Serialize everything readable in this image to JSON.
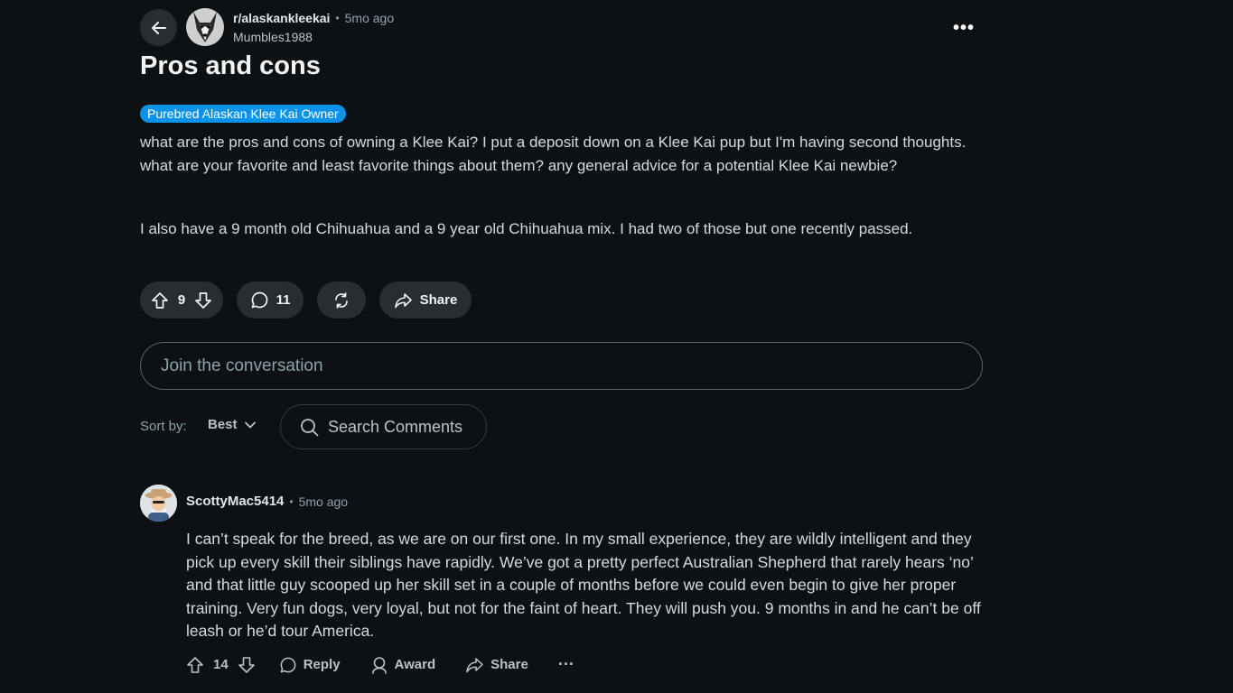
{
  "post": {
    "subreddit": "r/alaskankleekai",
    "separator": "•",
    "time": "5mo ago",
    "author": "Mumbles1988",
    "title": "Pros and cons",
    "flair": "Purebred Alaskan Klee Kai Owner",
    "body": [
      "what are the pros and cons of owning a Klee Kai? I put a deposit down on a Klee Kai pup but I'm having second thoughts. what are your favorite and least favorite things about them? any general advice for a potential Klee Kai newbie?",
      "I also have a 9 month old Chihuahua and a 9 year old Chihuahua mix. I had two of those but one recently passed."
    ],
    "score": "9",
    "comments_count": "11",
    "share_label": "Share",
    "more_label": "•••"
  },
  "comment_box": {
    "placeholder": "Join the conversation"
  },
  "sort": {
    "label": "Sort by:",
    "value": "Best"
  },
  "search_comments": {
    "placeholder": "Search Comments"
  },
  "comment": {
    "user": "ScottyMac5414",
    "separator": "•",
    "time": "5mo ago",
    "text": "I can’t speak for the breed, as we are on our first one. In my small experience, they are wildly intelligent and they pick up every skill their siblings have rapidly. We’ve got a pretty perfect Australian Shepherd that rarely hears ‘no’ and that little guy scooped up her skill set in a couple of months before we could even begin to give her proper training. Very fun dogs, very loyal, but not for the faint of heart. They will push you. 9 months in and he can’t be off leash or he’d tour America.",
    "score": "14",
    "reply_label": "Reply",
    "award_label": "Award",
    "share_label": "Share",
    "more_label": "···"
  },
  "colors": {
    "background": "#0e1113",
    "pill": "#272d30",
    "flair": "#0a93e8",
    "muted": "#8ba2ad"
  }
}
